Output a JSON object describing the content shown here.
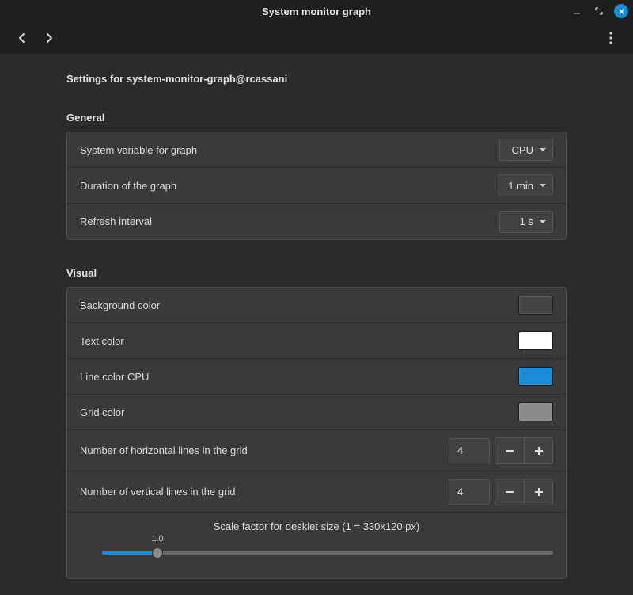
{
  "window": {
    "title": "System monitor graph"
  },
  "page": {
    "heading": "Settings for system-monitor-graph@rcassani"
  },
  "sections": {
    "general": {
      "title": "General",
      "rows": {
        "variable": {
          "label": "System variable for graph",
          "value": "CPU"
        },
        "duration": {
          "label": "Duration of the graph",
          "value": "1 min"
        },
        "refresh": {
          "label": "Refresh interval",
          "value": "1 s"
        }
      }
    },
    "visual": {
      "title": "Visual",
      "rows": {
        "bg": {
          "label": "Background color",
          "color": "#454545"
        },
        "text": {
          "label": "Text color",
          "color": "#ffffff"
        },
        "line": {
          "label": "Line color CPU",
          "color": "#1a8cd8"
        },
        "grid": {
          "label": "Grid color",
          "color": "#8a8a8a"
        },
        "hlines": {
          "label": "Number of horizontal lines in the grid",
          "value": "4"
        },
        "vlines": {
          "label": "Number of vertical lines in the grid",
          "value": "4"
        },
        "scale": {
          "caption": "Scale factor for desklet size (1 = 330x120 px)",
          "value": 1.0,
          "tick_label": "1.0"
        }
      }
    }
  }
}
